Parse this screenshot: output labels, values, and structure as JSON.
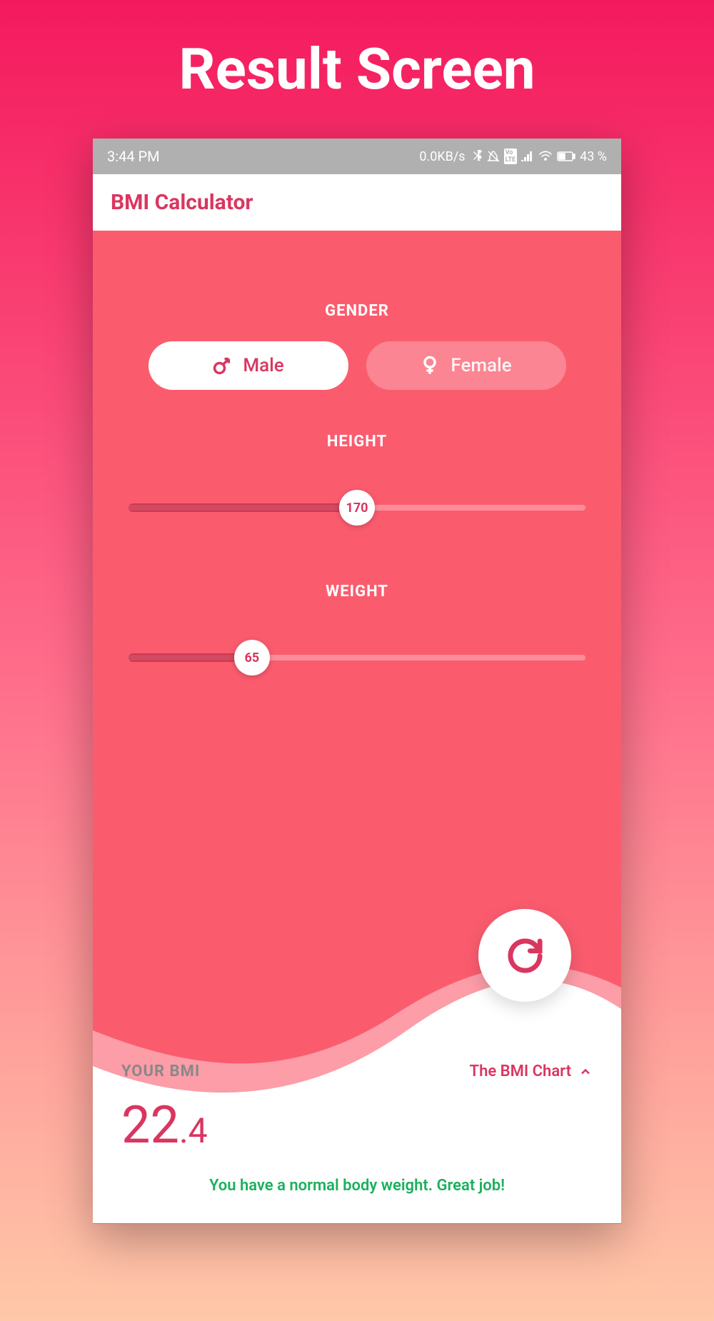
{
  "page_title": "Result Screen",
  "status_bar": {
    "time": "3:44 PM",
    "data_rate": "0.0KB/s",
    "battery": "43 %"
  },
  "app": {
    "title": "BMI Calculator"
  },
  "gender": {
    "label": "GENDER",
    "male": "Male",
    "female": "Female",
    "selected": "male"
  },
  "height": {
    "label": "HEIGHT",
    "value": "170",
    "percent": 50
  },
  "weight": {
    "label": "WEIGHT",
    "value": "65",
    "percent": 27
  },
  "result": {
    "your_bmi_label": "YOUR BMI",
    "chart_link": "The BMI Chart",
    "bmi_whole": "22",
    "bmi_decimal": ".4",
    "message": "You have a normal body weight. Great job!"
  }
}
